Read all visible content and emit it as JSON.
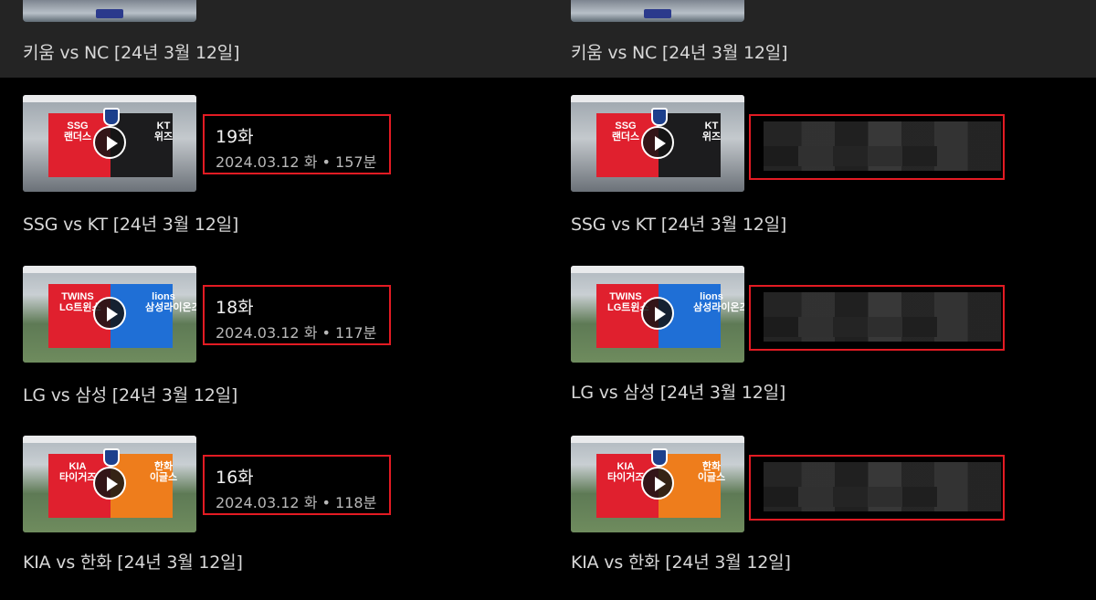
{
  "columns": [
    {
      "top_item": {
        "title": "키움 vs NC [24년 3월 12일]"
      },
      "items": [
        {
          "title": "SSG vs KT [24년 3월 12일]",
          "episode": "19화",
          "meta": "2024.03.12 화 • 157분",
          "home": "SSG\n랜더스",
          "away": "KT\n위즈"
        },
        {
          "title": "LG vs 삼성 [24년 3월 12일]",
          "episode": "18화",
          "meta": "2024.03.12 화 • 117분",
          "home": "TWINS\nLG트윈스",
          "away": "lions\n삼성라이온즈"
        },
        {
          "title": "KIA vs 한화 [24년 3월 12일]",
          "episode": "16화",
          "meta": "2024.03.12 화 • 118분",
          "home": "KIA\n타이거즈",
          "away": "한화\n이글스"
        }
      ]
    },
    {
      "top_item": {
        "title": "키움 vs NC [24년 3월 12일]"
      },
      "items": [
        {
          "title": "SSG vs KT [24년 3월 12일]",
          "home": "SSG\n랜더스",
          "away": "KT\n위즈"
        },
        {
          "title": "LG vs 삼성 [24년 3월 12일]",
          "home": "TWINS\nLG트윈스",
          "away": "lions\n삼성라이온즈"
        },
        {
          "title": "KIA vs 한화 [24년 3월 12일]",
          "home": "KIA\n타이거즈",
          "away": "한화\n이글스"
        }
      ]
    }
  ],
  "colors": {
    "highlight_border": "#e31b23",
    "background": "#000000",
    "top_band": "#242424"
  }
}
